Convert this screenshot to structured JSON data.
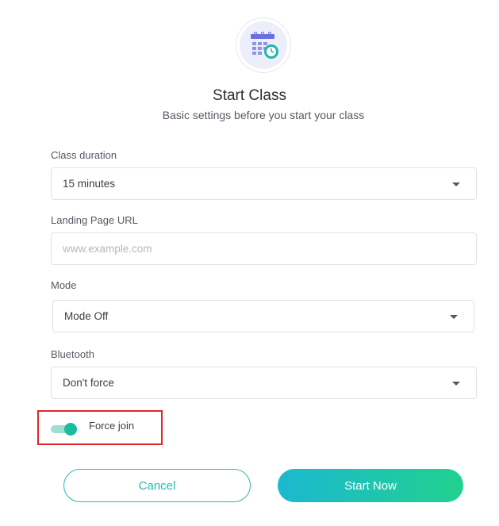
{
  "header": {
    "icon": "calendar-clock-icon",
    "title": "Start Class",
    "subtitle": "Basic settings before you start your class"
  },
  "form": {
    "class_duration": {
      "label": "Class duration",
      "value": "15 minutes"
    },
    "landing_page_url": {
      "label": "Landing Page URL",
      "value": "",
      "placeholder": "www.example.com"
    },
    "mode": {
      "label": "Mode",
      "value": "Mode Off"
    },
    "bluetooth": {
      "label": "Bluetooth",
      "value": "Don't force"
    },
    "force_join": {
      "label": "Force join",
      "enabled": true
    }
  },
  "actions": {
    "cancel_label": "Cancel",
    "start_label": "Start Now"
  },
  "colors": {
    "accent": "#1abc9c",
    "cancel_border": "#2ab8b0",
    "start_gradient_from": "#1bb8d0",
    "start_gradient_to": "#21d18f",
    "highlight": "#e0242b"
  }
}
